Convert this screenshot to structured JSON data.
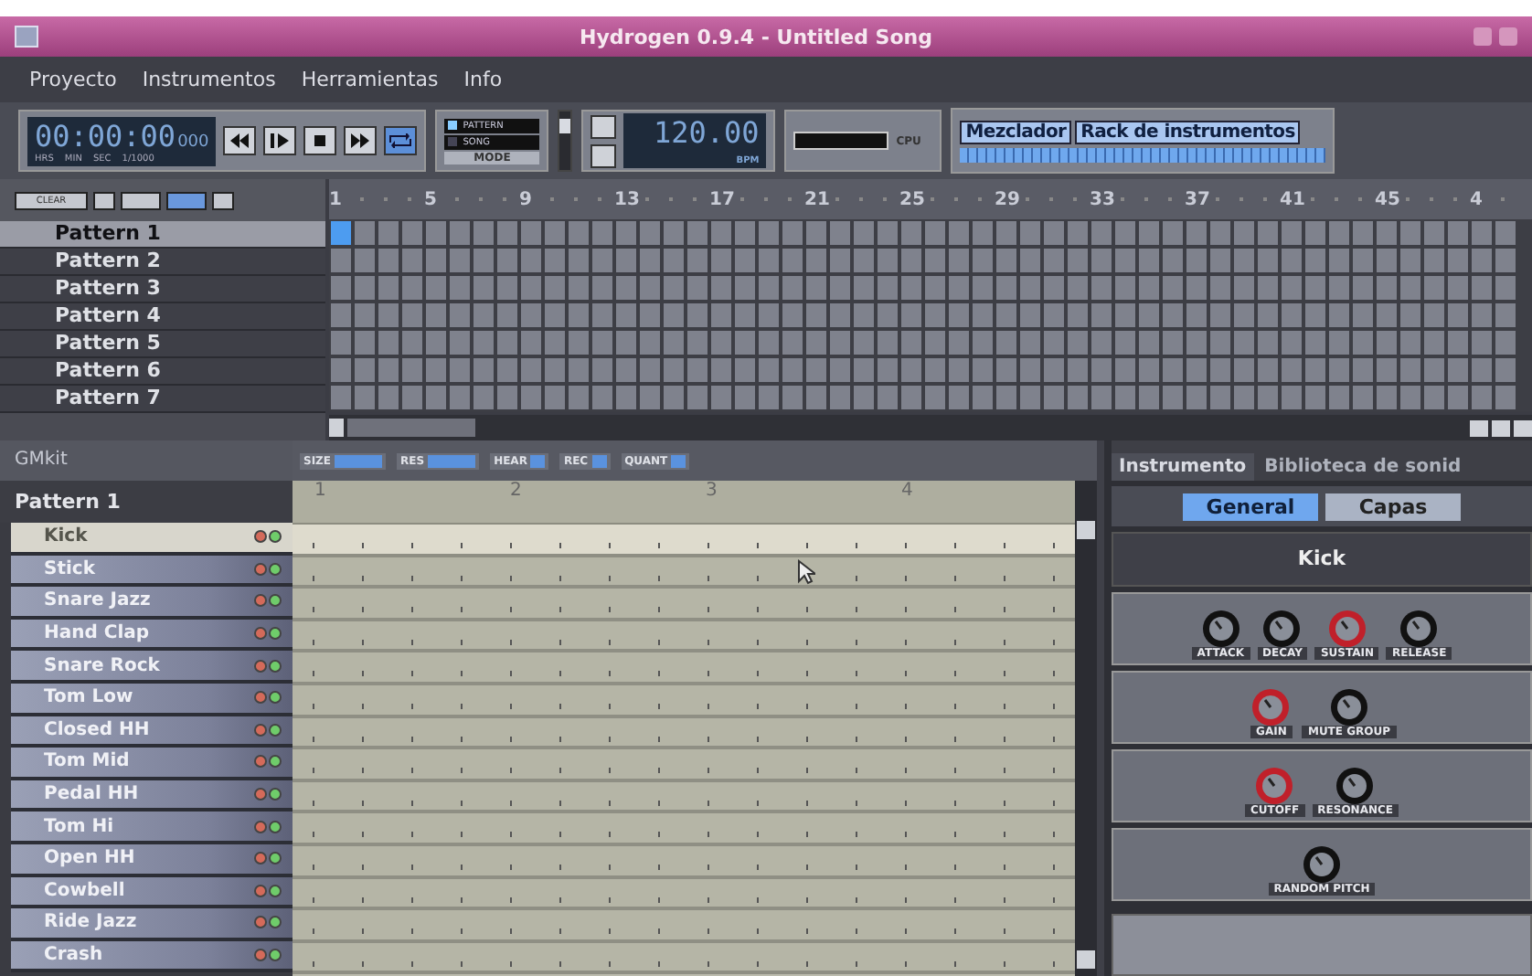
{
  "window": {
    "title": "Hydrogen 0.9.4 - Untitled Song"
  },
  "menu": [
    "Proyecto",
    "Instrumentos",
    "Herramientas",
    "Info"
  ],
  "toolbar": {
    "time": "00:00:00",
    "millis": "000",
    "time_labels": [
      "HRS",
      "MIN",
      "SEC",
      "1/1000"
    ],
    "transport": [
      {
        "kind": "rewind",
        "selected": false
      },
      {
        "kind": "play",
        "selected": false
      },
      {
        "kind": "stop",
        "selected": false
      },
      {
        "kind": "forward",
        "selected": false
      },
      {
        "kind": "loop",
        "selected": true
      }
    ],
    "modes": [
      {
        "label": "PATTERN",
        "selected": true
      },
      {
        "label": "SONG",
        "selected": false
      }
    ],
    "mode_label": "MODE",
    "volume": {
      "level": 0.85
    },
    "bpm": "120.00",
    "bpm_label": "BPM",
    "cpu_label": "CPU",
    "mixer_buttons": [
      {
        "label": "Mezclador",
        "selected": true
      },
      {
        "label": "Rack de instrumentos",
        "selected": true
      }
    ]
  },
  "song_editor": {
    "clear_button": "CLEAR",
    "ruler": [
      "1",
      "5",
      "9",
      "13",
      "17",
      "21",
      "25",
      "29",
      "33",
      "37",
      "41",
      "45",
      "4"
    ],
    "patterns": [
      {
        "name": "Pattern 1",
        "selected": true,
        "cells": [
          true,
          false,
          false,
          false,
          false,
          false,
          false,
          false,
          false,
          false,
          false,
          false,
          false,
          false,
          false,
          false,
          false,
          false,
          false,
          false,
          false,
          false,
          false,
          false,
          false,
          false,
          false,
          false,
          false,
          false,
          false,
          false,
          false,
          false,
          false,
          false,
          false,
          false,
          false,
          false,
          false,
          false,
          false,
          false,
          false,
          false,
          false,
          false,
          false,
          false
        ]
      },
      {
        "name": "Pattern 2",
        "selected": false,
        "cells": [
          false,
          false,
          false,
          false,
          false,
          false,
          false,
          false,
          false,
          false,
          false,
          false,
          false,
          false,
          false,
          false,
          false,
          false,
          false,
          false,
          false,
          false,
          false,
          false,
          false,
          false,
          false,
          false,
          false,
          false,
          false,
          false,
          false,
          false,
          false,
          false,
          false,
          false,
          false,
          false,
          false,
          false,
          false,
          false,
          false,
          false,
          false,
          false,
          false,
          false
        ]
      },
      {
        "name": "Pattern 3",
        "selected": false,
        "cells": [
          false,
          false,
          false,
          false,
          false,
          false,
          false,
          false,
          false,
          false,
          false,
          false,
          false,
          false,
          false,
          false,
          false,
          false,
          false,
          false,
          false,
          false,
          false,
          false,
          false,
          false,
          false,
          false,
          false,
          false,
          false,
          false,
          false,
          false,
          false,
          false,
          false,
          false,
          false,
          false,
          false,
          false,
          false,
          false,
          false,
          false,
          false,
          false,
          false,
          false
        ]
      },
      {
        "name": "Pattern 4",
        "selected": false,
        "cells": [
          false,
          false,
          false,
          false,
          false,
          false,
          false,
          false,
          false,
          false,
          false,
          false,
          false,
          false,
          false,
          false,
          false,
          false,
          false,
          false,
          false,
          false,
          false,
          false,
          false,
          false,
          false,
          false,
          false,
          false,
          false,
          false,
          false,
          false,
          false,
          false,
          false,
          false,
          false,
          false,
          false,
          false,
          false,
          false,
          false,
          false,
          false,
          false,
          false,
          false
        ]
      },
      {
        "name": "Pattern 5",
        "selected": false,
        "cells": [
          false,
          false,
          false,
          false,
          false,
          false,
          false,
          false,
          false,
          false,
          false,
          false,
          false,
          false,
          false,
          false,
          false,
          false,
          false,
          false,
          false,
          false,
          false,
          false,
          false,
          false,
          false,
          false,
          false,
          false,
          false,
          false,
          false,
          false,
          false,
          false,
          false,
          false,
          false,
          false,
          false,
          false,
          false,
          false,
          false,
          false,
          false,
          false,
          false,
          false
        ]
      },
      {
        "name": "Pattern 6",
        "selected": false,
        "cells": [
          false,
          false,
          false,
          false,
          false,
          false,
          false,
          false,
          false,
          false,
          false,
          false,
          false,
          false,
          false,
          false,
          false,
          false,
          false,
          false,
          false,
          false,
          false,
          false,
          false,
          false,
          false,
          false,
          false,
          false,
          false,
          false,
          false,
          false,
          false,
          false,
          false,
          false,
          false,
          false,
          false,
          false,
          false,
          false,
          false,
          false,
          false,
          false,
          false,
          false
        ]
      },
      {
        "name": "Pattern 7",
        "selected": false,
        "cells": [
          false,
          false,
          false,
          false,
          false,
          false,
          false,
          false,
          false,
          false,
          false,
          false,
          false,
          false,
          false,
          false,
          false,
          false,
          false,
          false,
          false,
          false,
          false,
          false,
          false,
          false,
          false,
          false,
          false,
          false,
          false,
          false,
          false,
          false,
          false,
          false,
          false,
          false,
          false,
          false,
          false,
          false,
          false,
          false,
          false,
          false,
          false,
          false,
          false,
          false
        ]
      }
    ]
  },
  "pattern_editor": {
    "drumkit": "GMkit",
    "pattern": "Pattern 1",
    "controls": [
      "SIZE",
      "RES",
      "HEAR",
      "REC",
      "QUANT"
    ],
    "ruler": [
      "1",
      "2",
      "3",
      "4"
    ],
    "instruments": [
      {
        "name": "Kick",
        "selected": true
      },
      {
        "name": "Stick",
        "selected": false
      },
      {
        "name": "Snare Jazz",
        "selected": false
      },
      {
        "name": "Hand Clap",
        "selected": false
      },
      {
        "name": "Snare Rock",
        "selected": false
      },
      {
        "name": "Tom Low",
        "selected": false
      },
      {
        "name": "Closed HH",
        "selected": false
      },
      {
        "name": "Tom Mid",
        "selected": false
      },
      {
        "name": "Pedal HH",
        "selected": false
      },
      {
        "name": "Tom Hi",
        "selected": false
      },
      {
        "name": "Open HH",
        "selected": false
      },
      {
        "name": "Cowbell",
        "selected": false
      },
      {
        "name": "Ride Jazz",
        "selected": false
      },
      {
        "name": "Crash",
        "selected": false
      }
    ]
  },
  "instrument_panel": {
    "tabs": [
      {
        "label": "Instrumento",
        "selected": true
      },
      {
        "label": "Biblioteca de sonid",
        "selected": false
      }
    ],
    "subtabs": [
      {
        "label": "General",
        "selected": true
      },
      {
        "label": "Capas",
        "selected": false
      }
    ],
    "instrument_name": "Kick",
    "sections": [
      {
        "knobs": [
          {
            "label": "ATTACK",
            "highlighted": false
          },
          {
            "label": "DECAY",
            "highlighted": false
          },
          {
            "label": "SUSTAIN",
            "highlighted": true
          },
          {
            "label": "RELEASE",
            "highlighted": false
          }
        ]
      },
      {
        "knobs": [
          {
            "label": "GAIN",
            "highlighted": true
          },
          {
            "label": "MUTE GROUP",
            "highlighted": false
          }
        ]
      },
      {
        "knobs": [
          {
            "label": "CUTOFF",
            "highlighted": true
          },
          {
            "label": "RESONANCE",
            "highlighted": false
          }
        ]
      },
      {
        "knobs": [
          {
            "label": "RANDOM PITCH",
            "highlighted": false
          }
        ]
      }
    ]
  }
}
